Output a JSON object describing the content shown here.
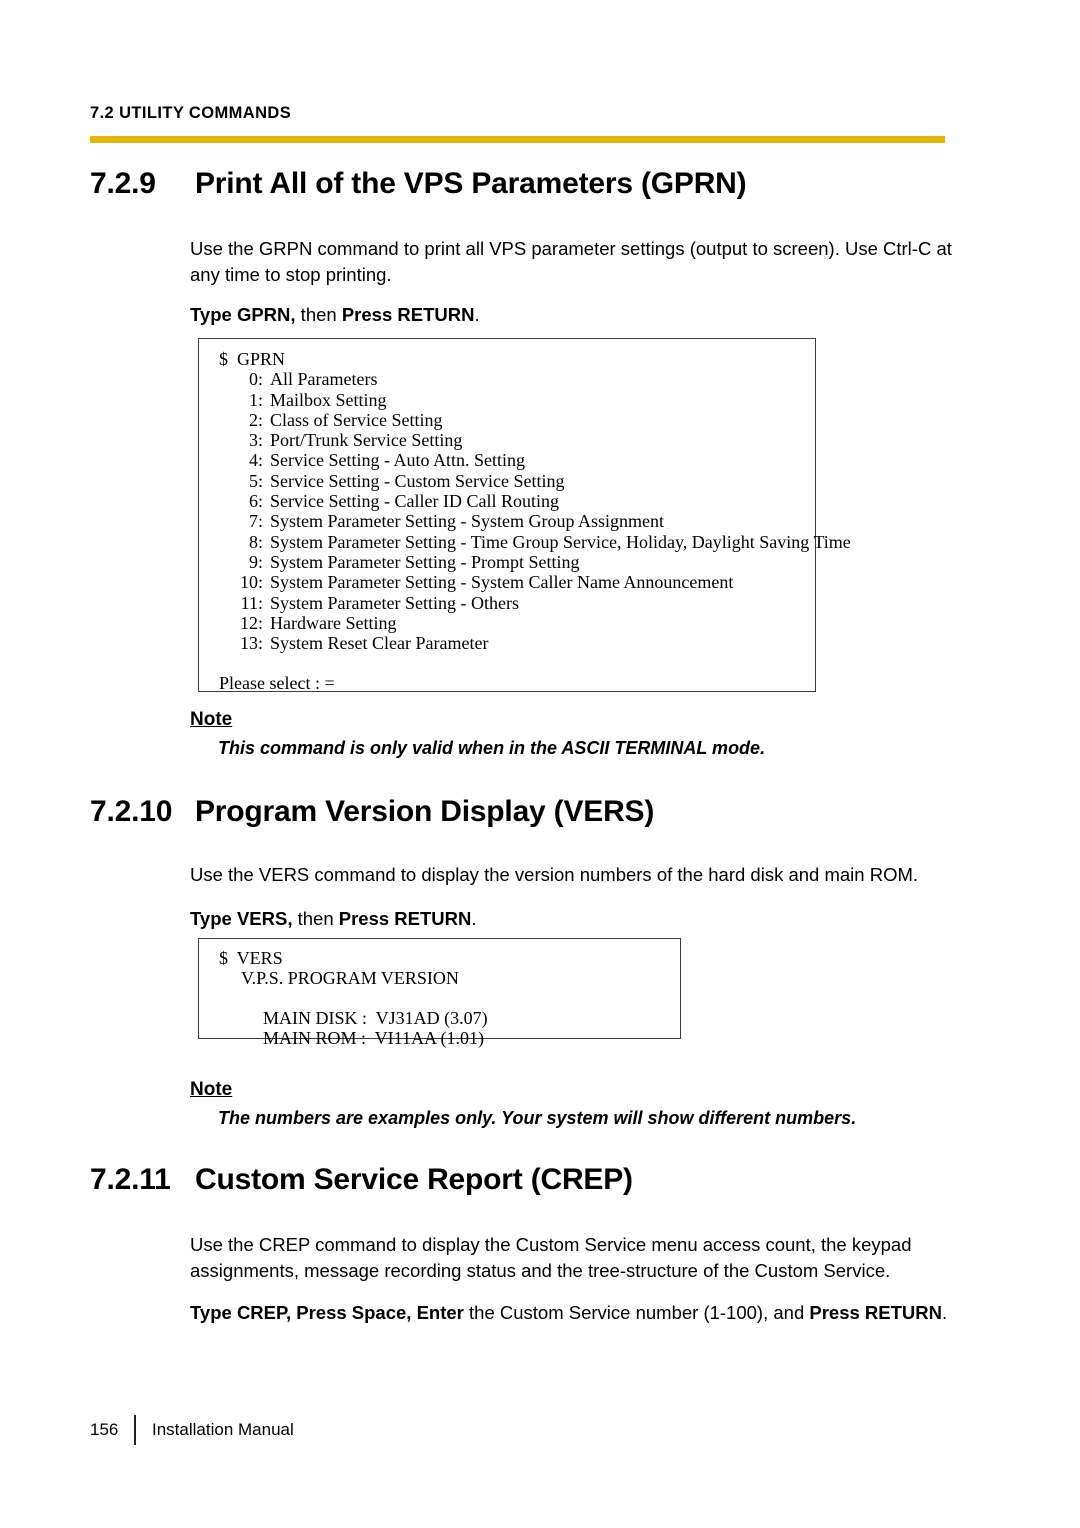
{
  "header": {
    "running_head": "7.2 UTILITY COMMANDS",
    "rule_color": "#E3B504"
  },
  "sections": [
    {
      "number": "7.2.9",
      "title": "Print All of the VPS Parameters (GPRN)",
      "paragraph": "Use the GRPN command to print all VPS parameter settings (output to screen). Use Ctrl-C at any time to stop printing.",
      "command_line": {
        "bold1": "Type GPRN,",
        "regular1": " then ",
        "bold2": "Press RETURN",
        "regular2": "."
      }
    },
    {
      "number": "7.2.10",
      "title": "Program Version Display (VERS)",
      "paragraph": "Use the VERS command to display the version numbers of the hard disk and main ROM.",
      "command_line": {
        "bold1": "Type VERS,",
        "regular1": " then ",
        "bold2": "Press RETURN",
        "regular2": "."
      }
    },
    {
      "number": "7.2.11",
      "title": "Custom Service Report (CREP)",
      "paragraph": "Use the CREP command to display the Custom Service menu access count, the keypad assignments, message recording status and the tree-structure of the Custom Service.",
      "command_line": {
        "bold1": "Type CREP, Press Space, Enter",
        "regular1": " the Custom Service number (1-100), and ",
        "bold2": "Press RETURN",
        "regular2": "."
      }
    }
  ],
  "gprn_terminal": {
    "prompt": "$  GPRN",
    "menu": [
      {
        "index": "0:",
        "label": "All Parameters"
      },
      {
        "index": "1:",
        "label": "Mailbox Setting"
      },
      {
        "index": "2:",
        "label": "Class of Service Setting"
      },
      {
        "index": "3:",
        "label": "Port/Trunk Service Setting"
      },
      {
        "index": "4:",
        "label": "Service Setting - Auto Attn. Setting"
      },
      {
        "index": "5:",
        "label": "Service Setting - Custom Service Setting"
      },
      {
        "index": "6:",
        "label": "Service Setting - Caller ID Call Routing"
      },
      {
        "index": "7:",
        "label": "System Parameter Setting - System Group Assignment"
      },
      {
        "index": "8:",
        "label": "System Parameter Setting - Time Group Service, Holiday, Daylight Saving Time"
      },
      {
        "index": "9:",
        "label": "System Parameter Setting - Prompt Setting"
      },
      {
        "index": "10:",
        "label": "System Parameter Setting - System Caller Name Announcement"
      },
      {
        "index": "11:",
        "label": "System Parameter Setting - Others"
      },
      {
        "index": "12:",
        "label": "Hardware Setting"
      },
      {
        "index": "13:",
        "label": "System Reset Clear Parameter"
      }
    ],
    "select_prompt": "Please select : ="
  },
  "vers_terminal": {
    "prompt": "$  VERS",
    "title_line": "V.P.S. PROGRAM VERSION",
    "main_disk": "MAIN DISK :  VJ31AD (3.07)",
    "main_rom": "MAIN ROM :  VI11AA (1.01)"
  },
  "notes": [
    {
      "title": "Note",
      "text": "This command is only valid when in the ASCII TERMINAL mode."
    },
    {
      "title": "Note",
      "text": "The numbers are examples only. Your system will show different numbers."
    }
  ],
  "footer": {
    "page_number": "156",
    "manual_name": "Installation Manual"
  }
}
